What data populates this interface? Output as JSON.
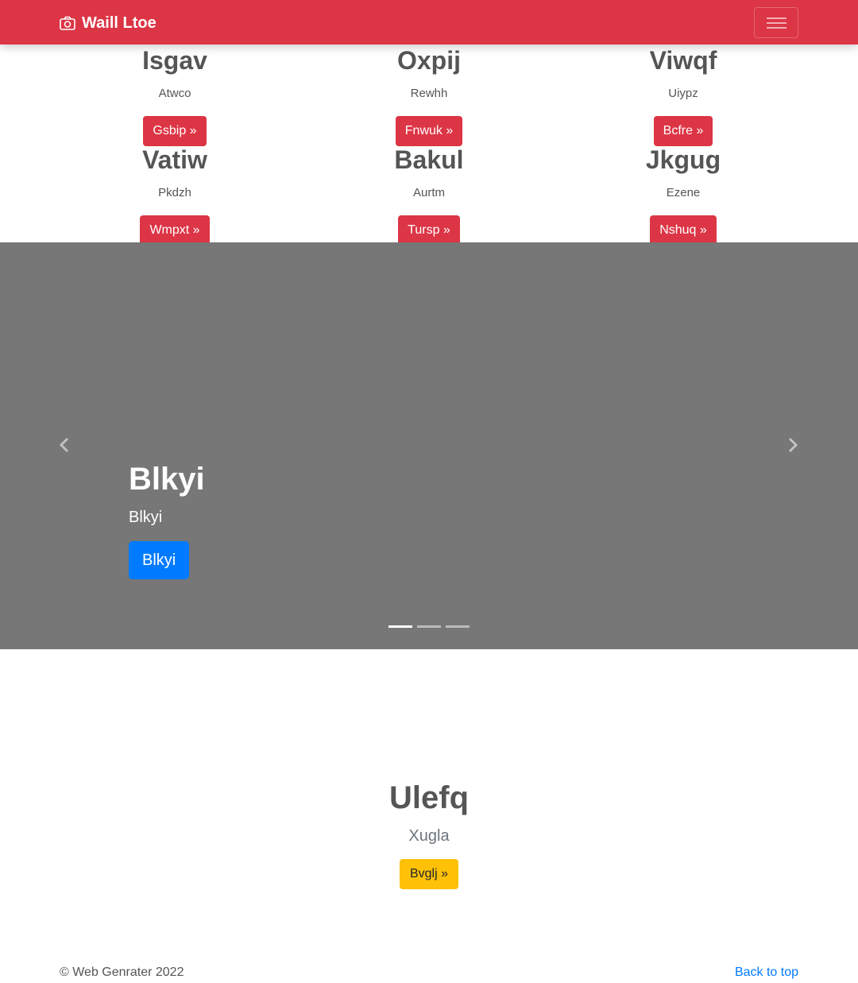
{
  "navbar": {
    "brand": "Waill Ltoe",
    "brand_icon": "camera-icon",
    "toggler_icon": "hamburger-icon",
    "color": "#dc3545"
  },
  "features": [
    {
      "title": "Isgav",
      "text": "Atwco",
      "button": "Gsbip »"
    },
    {
      "title": "Oxpij",
      "text": "Rewhh",
      "button": "Fnwuk »"
    },
    {
      "title": "Viwqf",
      "text": "Uiypz",
      "button": "Bcfre »"
    },
    {
      "title": "Vatiw",
      "text": "Pkdzh",
      "button": "Wmpxt »"
    },
    {
      "title": "Bakul",
      "text": "Aurtm",
      "button": "Tursp »"
    },
    {
      "title": "Jkgug",
      "text": "Ezene",
      "button": "Nshuq »"
    }
  ],
  "carousel": {
    "heading": "Blkyi",
    "text": "Blkyi",
    "button": "Blkyi",
    "slides_count": 3,
    "active_slide": 1,
    "prev_icon": "chevron-left-icon",
    "next_icon": "chevron-right-icon",
    "background": "#777777",
    "button_color": "#007bff"
  },
  "hero": {
    "title": "Ulefq",
    "text": "Xugla",
    "button": "Bvglj »",
    "button_color": "#ffc107"
  },
  "footer": {
    "copyright": "© Web Genrater 2022",
    "back_to_top": "Back to top"
  }
}
